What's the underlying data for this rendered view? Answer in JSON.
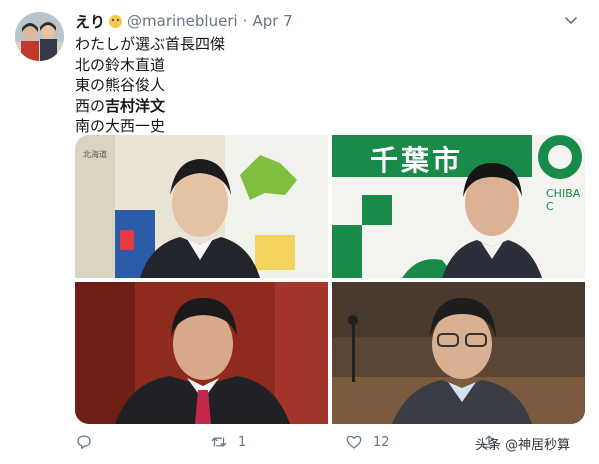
{
  "tweet": {
    "display_name": "えり",
    "handle": "@marineblueri",
    "separator": "·",
    "date": "Apr 7",
    "lines": {
      "l1": "わたしが選ぶ首長四傑",
      "l2": "北の鈴木直道",
      "l3": "東の熊谷俊人",
      "l4_prefix": "西の",
      "l4_bold": "吉村洋文",
      "l5": "南の大西一史"
    },
    "photo1": {
      "sign_text": "北海道"
    },
    "photo2": {
      "sign_text": "千葉市",
      "sign_text_en": "CHIBA C"
    }
  },
  "actions": {
    "reply_count": "",
    "retweet_count": "1",
    "like_count": "12"
  },
  "watermark": "头条 @神居秒算",
  "colors": {
    "muted": "#657786",
    "text": "#14171a",
    "chiba_green": "#1a8a4a"
  }
}
